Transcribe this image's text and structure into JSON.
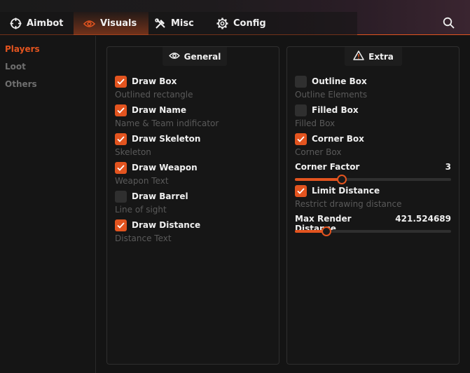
{
  "tabs": [
    {
      "label": "Aimbot",
      "icon": "crosshair-icon"
    },
    {
      "label": "Visuals",
      "icon": "eye-icon",
      "active": true
    },
    {
      "label": "Misc",
      "icon": "tools-icon"
    },
    {
      "label": "Config",
      "icon": "gear-icon"
    }
  ],
  "sidebar": {
    "items": [
      {
        "label": "Players",
        "active": true
      },
      {
        "label": "Loot"
      },
      {
        "label": "Others"
      }
    ]
  },
  "general": {
    "title": "General",
    "options": [
      {
        "label": "Draw Box",
        "desc": "Outlined rectangle",
        "checked": true
      },
      {
        "label": "Draw Name",
        "desc": "Name & Team indificator",
        "checked": true
      },
      {
        "label": "Draw Skeleton",
        "desc": "Skeleton",
        "checked": true
      },
      {
        "label": "Draw Weapon",
        "desc": "Weapon Text",
        "checked": true
      },
      {
        "label": "Draw Barrel",
        "desc": "Line of sight",
        "checked": false
      },
      {
        "label": "Draw Distance",
        "desc": "Distance Text",
        "checked": true
      }
    ]
  },
  "extra": {
    "title": "Extra",
    "options": [
      {
        "label": "Outline Box",
        "desc": "Outline Elements",
        "checked": false
      },
      {
        "label": "Filled Box",
        "desc": "Filled Box",
        "checked": false
      },
      {
        "label": "Corner Box",
        "desc": "Corner Box",
        "checked": true
      }
    ],
    "corner_factor": {
      "label": "Corner Factor",
      "value": "3",
      "fraction": 0.3
    },
    "limit_distance": {
      "label": "Limit Distance",
      "desc": "Restrict drawing distance",
      "checked": true
    },
    "max_render": {
      "label": "Max Render Distance",
      "value": "421.524689",
      "fraction": 0.2
    }
  },
  "colors": {
    "accent": "#e3541f",
    "checkbox_off": "#2f2f2f"
  }
}
